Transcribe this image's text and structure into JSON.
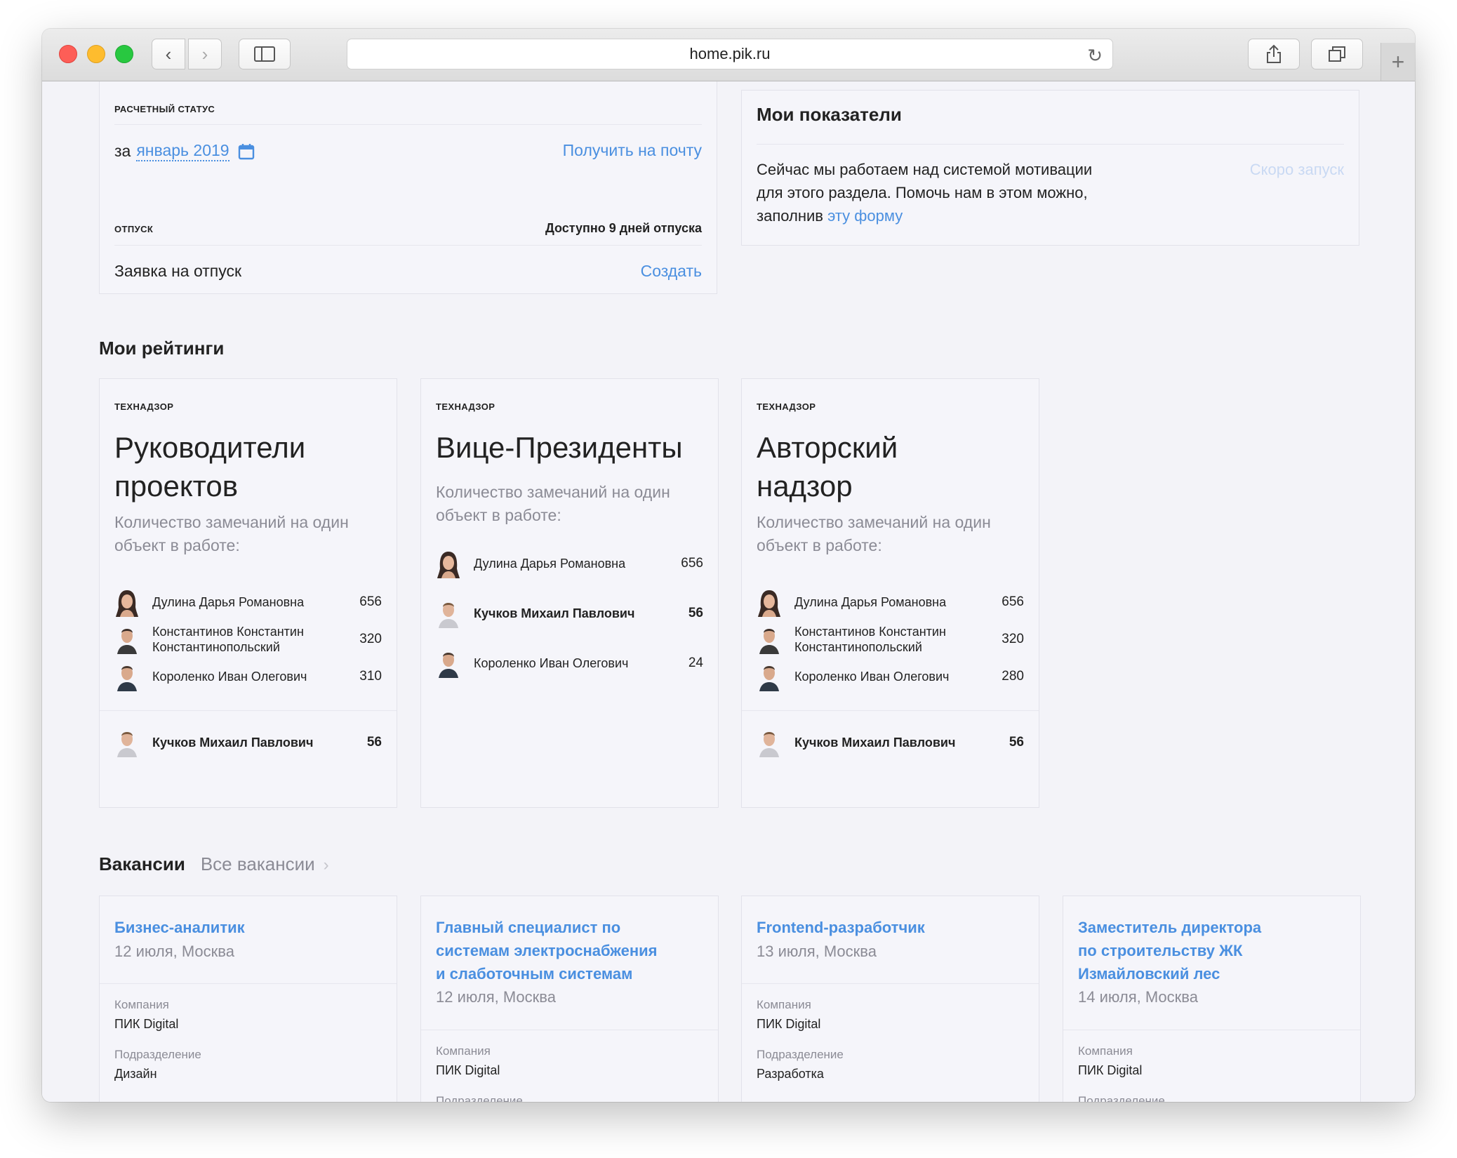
{
  "browser": {
    "url": "home.pik.ru"
  },
  "settlement": {
    "caps": "РАСЧЕТНЫЙ СТАТУС",
    "for_prefix": "за",
    "month": "январь 2019",
    "email_link": "Получить на почту",
    "vacation_caps": "ОТПУСК",
    "vacation_available": "Доступно 9 дней отпуска",
    "vacation_request": "Заявка на отпуск",
    "create_link": "Создать"
  },
  "indicators": {
    "title": "Мои показатели",
    "text_line1": "Сейчас мы работаем над системой мотивации",
    "text_line2": "для этого раздела. Помочь нам в этом можно,",
    "text_line3_prefix": "заполнив",
    "form_link": "эту форму",
    "coming_soon": "Скоро запуск"
  },
  "ratings": {
    "heading": "Мои рейтинги",
    "cards": [
      {
        "caps": "ТЕХНАДЗОР",
        "title_line1": "Руководители",
        "title_line2": "проектов",
        "desc_line1": "Количество замечаний на один",
        "desc_line2": "объект в работе:",
        "people": [
          {
            "name_line1": "Дулина Дарья Романовна",
            "name_line2": "",
            "score": "656"
          },
          {
            "name_line1": "Константинов Константин",
            "name_line2": "Константинопольский",
            "score": "320"
          },
          {
            "name_line1": "Короленко Иван Олегович",
            "name_line2": "",
            "score": "310"
          }
        ],
        "me": {
          "name": "Кучков Михаил Павлович",
          "score": "56"
        }
      },
      {
        "caps": "ТЕХНАДЗОР",
        "title_line1": "Вице-Президенты",
        "desc_line1": "Количество замечаний на один",
        "desc_line2": "объект в работе:",
        "people": [
          {
            "name_line1": "Дулина Дарья Романовна",
            "score": "656"
          },
          {
            "name_line1": "Кучков Михаил Павлович",
            "score": "56"
          },
          {
            "name_line1": "Короленко Иван Олегович",
            "score": "24"
          }
        ]
      },
      {
        "caps": "ТЕХНАДЗОР",
        "title_line1": "Авторский",
        "title_line2": "надзор",
        "desc_line1": "Количество замечаний на один",
        "desc_line2": "объект в работе:",
        "people": [
          {
            "name_line1": "Дулина Дарья Романовна",
            "name_line2": "",
            "score": "656"
          },
          {
            "name_line1": "Константинов Константин",
            "name_line2": "Константинопольский",
            "score": "320"
          },
          {
            "name_line1": "Короленко Иван Олегович",
            "name_line2": "",
            "score": "280"
          }
        ],
        "me": {
          "name": "Кучков Михаил Павлович",
          "score": "56"
        }
      }
    ]
  },
  "vacancies": {
    "heading": "Вакансии",
    "all_link": "Все вакансии",
    "company_label": "Компания",
    "department_label": "Подразделение",
    "cards": [
      {
        "title_line1": "Бизнес-аналитик",
        "date": "12 июля, Москва",
        "company": "ПИК Digital",
        "department": "Дизайн"
      },
      {
        "title_line1": "Главный специалист по",
        "title_line2": "системам электроснабжения",
        "title_line3": "и слаботочным системам",
        "date": "12 июля, Москва",
        "company": "ПИК Digital"
      },
      {
        "title_line1": "Frontend-разработчик",
        "date": "13 июля, Москва",
        "company": "ПИК Digital",
        "department": "Разработка"
      },
      {
        "title_line1": "Заместитель директора",
        "title_line2": "по строительству ЖК",
        "title_line3": "Измайловский лес",
        "date": "14 июля, Москва",
        "company": "ПИК Digital"
      }
    ]
  },
  "colors": {
    "accent": "#4a8fe0",
    "muted": "#8b8b95",
    "background": "#f3f3f8"
  }
}
